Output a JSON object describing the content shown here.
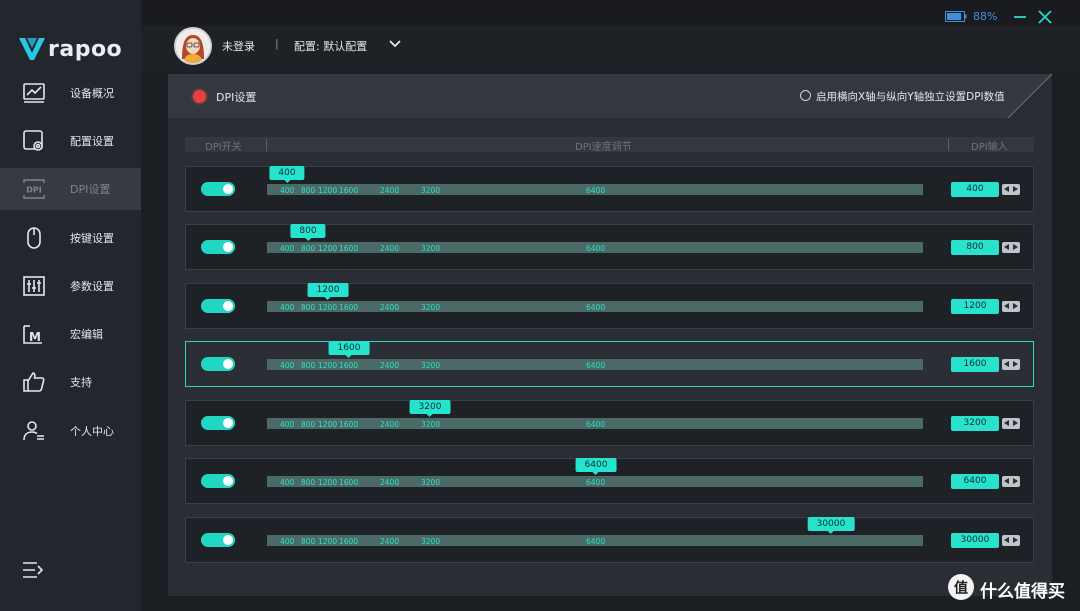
{
  "app": {
    "brand": "rapoo"
  },
  "sidebar": {
    "items": [
      {
        "label": "设备概况",
        "icon": "chart-monitor-icon"
      },
      {
        "label": "配置设置",
        "icon": "config-gear-icon"
      },
      {
        "label": "DPI设置",
        "icon": "dpi-icon"
      },
      {
        "label": "按键设置",
        "icon": "mouse-icon"
      },
      {
        "label": "参数设置",
        "icon": "sliders-icon"
      },
      {
        "label": "宏编辑",
        "icon": "macro-icon"
      },
      {
        "label": "支持",
        "icon": "thumbs-up-icon"
      },
      {
        "label": "个人中心",
        "icon": "user-icon"
      }
    ],
    "active_index": 2
  },
  "header": {
    "user": "未登录",
    "separator": "|",
    "profile": "配置: 默认配置",
    "battery": "88%",
    "battery_level": 0.88
  },
  "dpi": {
    "title": "DPI设置",
    "xy_option": "启用横向X轴与纵向Y轴独立设置DPI数值",
    "columns": {
      "switch": "DPI开关",
      "slider": "DPI速度调节",
      "input": "DPI输入"
    },
    "ticks": [
      "400",
      "800",
      "1200",
      "1600",
      "2400",
      "3200",
      "6400"
    ],
    "rows": [
      {
        "value": "400",
        "input": "400",
        "enabled": true
      },
      {
        "value": "800",
        "input": "800",
        "enabled": true
      },
      {
        "value": "1200",
        "input": "1200",
        "enabled": true
      },
      {
        "value": "1600",
        "input": "1600",
        "enabled": true,
        "selected": true
      },
      {
        "value": "3200",
        "input": "3200",
        "enabled": true
      },
      {
        "value": "6400",
        "input": "6400",
        "enabled": true
      },
      {
        "value": "30000",
        "input": "30000",
        "enabled": true
      }
    ]
  },
  "colors": {
    "accent": "#25e3cf",
    "indicator": "#e84040",
    "battery": "#3f8fd9"
  },
  "watermark": {
    "text": "什么值得买"
  }
}
